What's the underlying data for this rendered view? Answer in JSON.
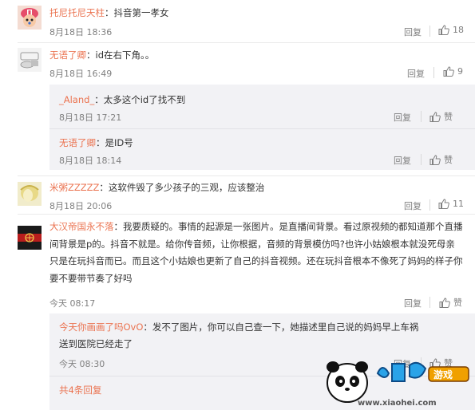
{
  "colors": {
    "username": "#eb7350",
    "meta": "#808080",
    "text": "#333333",
    "reply_bg": "#f2f2f5"
  },
  "icons": {
    "like": "thumbs-up-icon"
  },
  "comments": [
    {
      "user": "托尼托尼天柱",
      "text": "：抖音第一孝女",
      "time": "8月18日 18:36",
      "reply": "回复",
      "likes": "18"
    },
    {
      "user": "无语了卿",
      "text": "：id在右下角。。",
      "time": "8月18日 16:49",
      "reply": "回复",
      "likes": "9",
      "replies": [
        {
          "user": "_Aland_",
          "text": "：太多这个id了找不到",
          "time": "8月18日 17:21",
          "reply": "回复",
          "like": "赞"
        },
        {
          "user": "无语了卿",
          "text": "：是ID号",
          "time": "8月18日 18:14",
          "reply": "回复",
          "like": "赞"
        }
      ]
    },
    {
      "user": "米粥ZZZZZ",
      "text": "：这软件毁了多少孩子的三观，应该整治",
      "time": "8月18日 20:06",
      "reply": "回复",
      "likes": "11"
    },
    {
      "user": "大汉帝国永不落",
      "text": "：我要质疑的。事情的起源是一张图片。是直播间背景。看过原视频的都知道那个直播间背景是p的。抖音不就是。给你传音频，让你根据，音频的背景模仿吗?也许小姑娘根本就没死母亲只是在玩抖音而已。而且这个小姑娘也更新了自己的抖音视频。还在玩抖音根本不像死了妈妈的样子你要不要带节奏了好吗",
      "time": "今天 08:17",
      "reply": "回复",
      "like": "赞",
      "replies": [
        {
          "user": "今天你画画了吗OvO",
          "text": "：发不了图片，你可以自己查一下，她描述里自己说的妈妈早上车祸送到医院已经走了",
          "time": "今天 08:30",
          "reply": "回复",
          "like": "赞"
        }
      ],
      "more": "共4条回复"
    }
  ],
  "watermark": {
    "site": "www.xiaohei.com"
  }
}
